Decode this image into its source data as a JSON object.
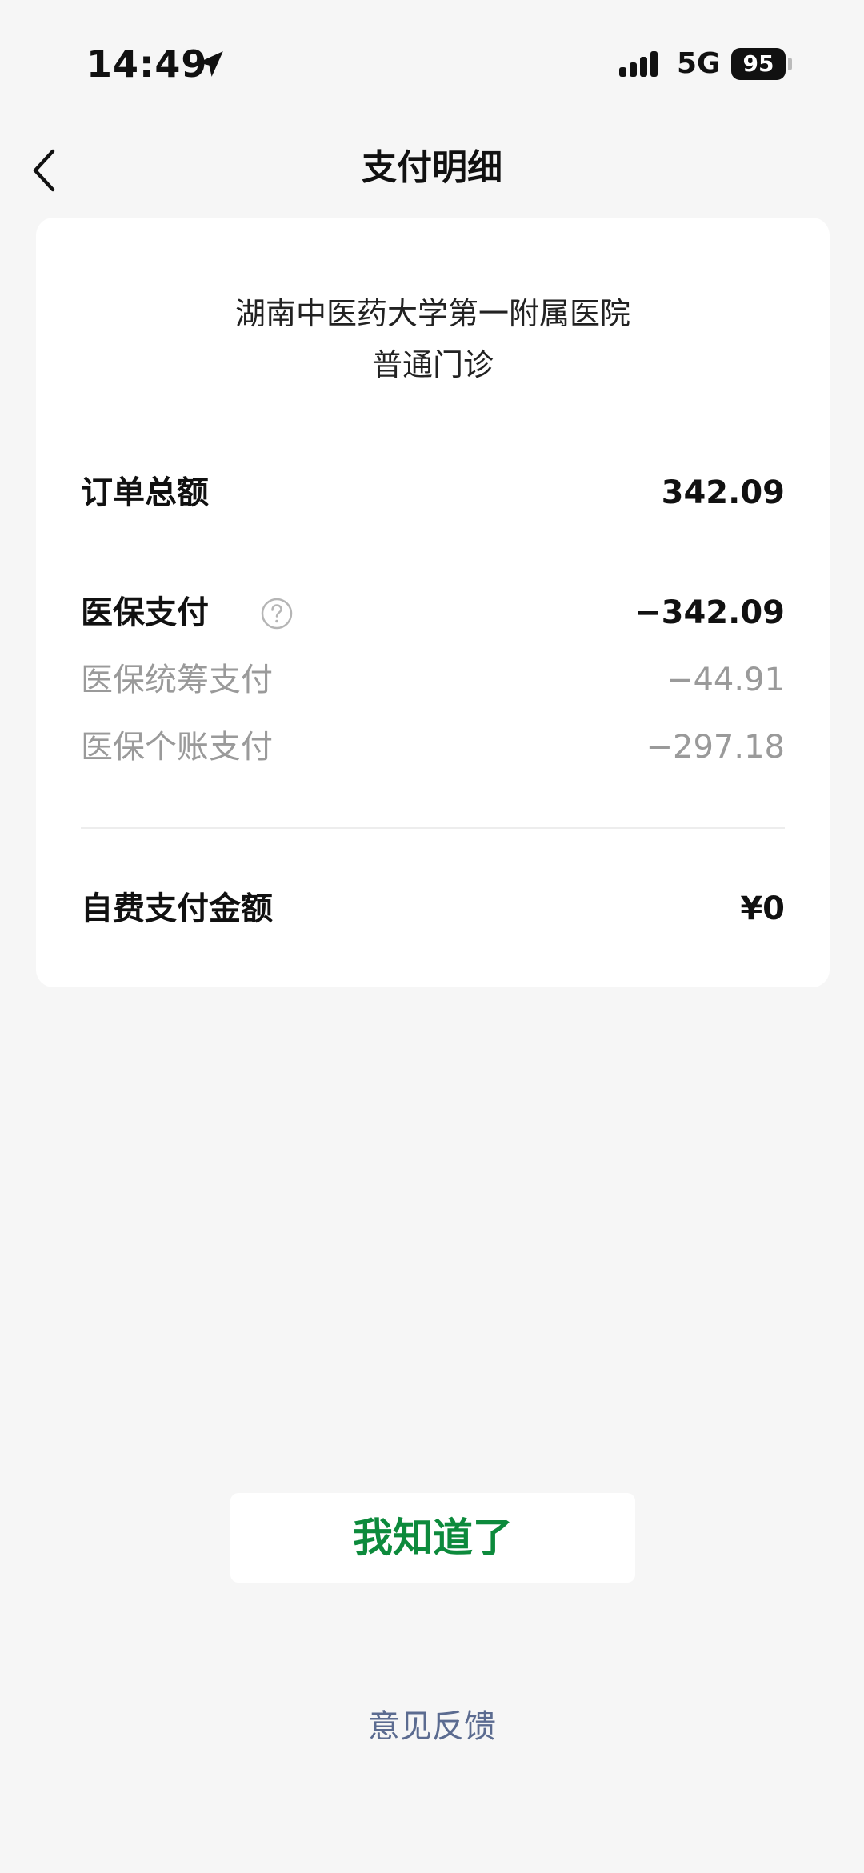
{
  "status_bar": {
    "time": "14:49",
    "network": "5G",
    "battery": "95",
    "icons": [
      "location-arrow-icon",
      "signal-icon",
      "battery-icon"
    ]
  },
  "nav": {
    "title": "支付明细",
    "back_icon": "chevron-left-icon"
  },
  "card": {
    "hospital": "湖南中医药大学第一附属医院",
    "clinic": "普通门诊",
    "order_total": {
      "label": "订单总额",
      "value": "342.09"
    },
    "insurance": {
      "label": "医保支付",
      "value": "−342.09",
      "help_icon": "question-circle-icon"
    },
    "pooled": {
      "label": "医保统筹支付",
      "value": "−44.91"
    },
    "personal": {
      "label": "医保个账支付",
      "value": "−297.18"
    },
    "self_pay": {
      "label": "自费支付金额",
      "value": "¥0"
    }
  },
  "actions": {
    "confirm_label": "我知道了",
    "feedback_label": "意见反馈"
  },
  "colors": {
    "accent_green": "#0d8a3c",
    "link_blue": "#5b6b90",
    "muted_gray": "#9a9a9a",
    "background": "#f6f6f6"
  }
}
